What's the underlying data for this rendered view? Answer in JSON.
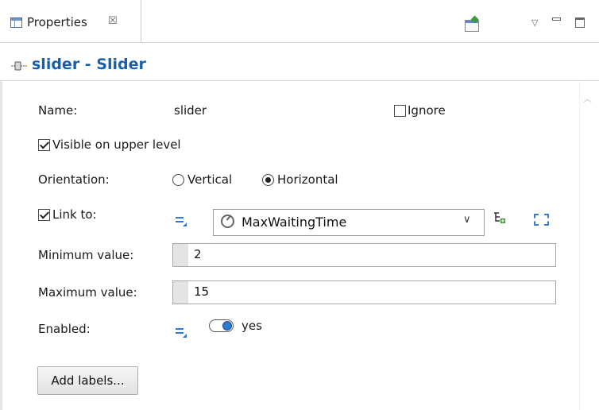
{
  "tab": {
    "label": "Properties",
    "close_glyph": "☒"
  },
  "header": {
    "title": "slider - Slider",
    "icon": "slider-icon"
  },
  "toolbar": {
    "icons": [
      "export-icon",
      "view-menu-icon",
      "minimize-icon",
      "maximize-icon"
    ]
  },
  "form": {
    "name_label": "Name:",
    "name_value": "slider",
    "ignore_label": "Ignore",
    "ignore_checked": false,
    "visible_label": "Visible on upper level",
    "visible_checked": true,
    "orientation_label": "Orientation:",
    "orientation_options": [
      "Vertical",
      "Horizontal"
    ],
    "orientation_selected": "Horizontal",
    "link_label": "Link to:",
    "link_checked": true,
    "link_value": "MaxWaitingTime",
    "min_label": "Minimum value:",
    "min_value": "2",
    "max_label": "Maximum value:",
    "max_value": "15",
    "enabled_label": "Enabled:",
    "enabled_value": "yes",
    "add_labels_button": "Add labels..."
  },
  "colors": {
    "title_blue": "#1a5fae",
    "accent_blue": "#2f7ad1"
  }
}
